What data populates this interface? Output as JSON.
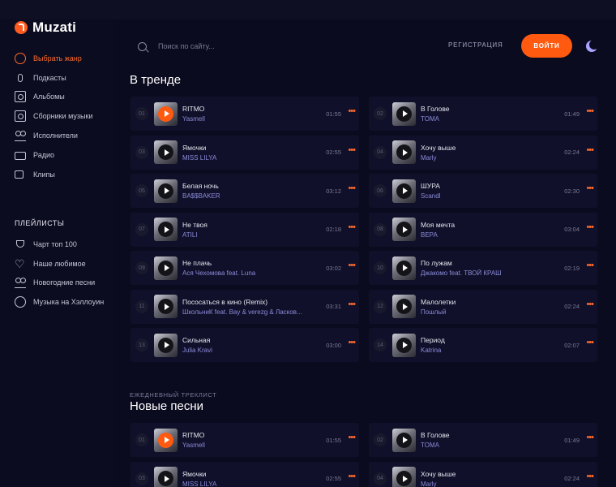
{
  "brand": {
    "name": "Muzati"
  },
  "sidebar": {
    "items": [
      {
        "label": "Выбрать жанр",
        "icon": "genre-icon"
      },
      {
        "label": "Подкасты",
        "icon": "microphone-icon"
      },
      {
        "label": "Альбомы",
        "icon": "album-icon"
      },
      {
        "label": "Сборники музыки",
        "icon": "collection-icon"
      },
      {
        "label": "Исполнители",
        "icon": "artists-icon"
      },
      {
        "label": "Радио",
        "icon": "radio-icon"
      },
      {
        "label": "Клипы",
        "icon": "video-icon"
      }
    ],
    "playlists_title": "ПЛЕЙЛИСТЫ",
    "playlists": [
      {
        "label": "Чарт топ 100",
        "icon": "trophy-icon"
      },
      {
        "label": "Наше любимое",
        "icon": "heart-icon"
      },
      {
        "label": "Новогодние песни",
        "icon": "snowman-icon"
      },
      {
        "label": "Музыка на Хэллоуин",
        "icon": "pumpkin-icon"
      }
    ]
  },
  "header": {
    "search_placeholder": "Поиск по сайту...",
    "register_label": "РЕГИСТРАЦИЯ",
    "login_label": "ВОЙТИ"
  },
  "trending": {
    "title": "В тренде",
    "tracks": [
      {
        "num": "01",
        "title": "RITMO",
        "artist": "Yasmell",
        "duration": "01:55",
        "active": true
      },
      {
        "num": "02",
        "title": "В Голове",
        "artist": "TOMA",
        "duration": "01:49"
      },
      {
        "num": "03",
        "title": "Ямочки",
        "artist": "MISS LILYA",
        "duration": "02:55"
      },
      {
        "num": "04",
        "title": "Хочу выше",
        "artist": "Marly",
        "duration": "02:24"
      },
      {
        "num": "05",
        "title": "Белая ночь",
        "artist": "BA$$BAKER",
        "duration": "03:12"
      },
      {
        "num": "06",
        "title": "ШУРА",
        "artist": "Scandl",
        "duration": "02:30"
      },
      {
        "num": "07",
        "title": "Не твоя",
        "artist": "ATILI",
        "duration": "02:18"
      },
      {
        "num": "08",
        "title": "Моя мечта",
        "artist": "ВЕРА",
        "duration": "03:04"
      },
      {
        "num": "09",
        "title": "Не плачь",
        "artist": "Ася Чехомова feat. Luna",
        "duration": "03:02"
      },
      {
        "num": "10",
        "title": "По лужам",
        "artist": "Джакомо feat. ТВОЙ КРАШ",
        "duration": "02:19"
      },
      {
        "num": "11",
        "title": "Пососаться в кино (Remix)",
        "artist": "ШкольниК feat. Bay & verezg & Ласков...",
        "duration": "03:31"
      },
      {
        "num": "12",
        "title": "Малолетки",
        "artist": "Пошлый",
        "duration": "02:24"
      },
      {
        "num": "13",
        "title": "Сильная",
        "artist": "Julia Kravi",
        "duration": "03:00"
      },
      {
        "num": "14",
        "title": "Период",
        "artist": "Katrina",
        "duration": "02:07"
      }
    ]
  },
  "new_songs": {
    "subtitle": "ЕЖЕДНЕВНЫЙ ТРЕКЛИСТ",
    "title": "Новые песни",
    "tracks": [
      {
        "num": "01",
        "title": "RITMO",
        "artist": "Yasmell",
        "duration": "01:55",
        "active": true
      },
      {
        "num": "02",
        "title": "В Голове",
        "artist": "TOMA",
        "duration": "01:49"
      },
      {
        "num": "03",
        "title": "Ямочки",
        "artist": "MISS LILYA",
        "duration": "02:55"
      },
      {
        "num": "04",
        "title": "Хочу выше",
        "artist": "Marly",
        "duration": "02:24"
      }
    ]
  },
  "colors": {
    "accent": "#ff5a10",
    "artist": "#8b8bd8",
    "background": "#0b0b1f"
  }
}
